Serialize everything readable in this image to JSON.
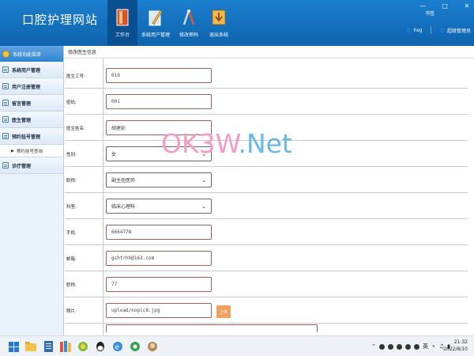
{
  "header": {
    "site_title": "口腔护理网站",
    "nav": [
      {
        "label": "工作台",
        "icon": "book-icon",
        "active": true
      },
      {
        "label": "系统用户管理",
        "icon": "pencil-icon",
        "active": false
      },
      {
        "label": "修改密码",
        "icon": "tools-icon",
        "active": false
      },
      {
        "label": "退出系统",
        "icon": "download-icon",
        "active": false
      }
    ],
    "bookmark": "书签",
    "window_controls": [
      "—",
      "□",
      "✕"
    ],
    "user_name": "hsg",
    "user_role": "超级管理员"
  },
  "sidebar": {
    "header": "系统功能菜单",
    "items": [
      {
        "label": "系统用户管理"
      },
      {
        "label": "用户注册管理"
      },
      {
        "label": "留言管理"
      },
      {
        "label": "医生管理"
      },
      {
        "label": "预约挂号管理"
      }
    ],
    "sub_item": "预约挂号查询",
    "last_item": "诊疗管理"
  },
  "main": {
    "breadcrumb": "修改医生信息",
    "fields": [
      {
        "label": "医生工号:",
        "value": "019",
        "type": "input"
      },
      {
        "label": "密码:",
        "value": "001",
        "type": "input"
      },
      {
        "label": "医生姓名:",
        "value": "胡建彭",
        "type": "input"
      },
      {
        "label": "性别:",
        "value": "女",
        "type": "select"
      },
      {
        "label": "职称:",
        "value": "副主任医师",
        "type": "select"
      },
      {
        "label": "科室:",
        "value": "临床心理科",
        "type": "select"
      },
      {
        "label": "手机:",
        "value": "6664778",
        "type": "input"
      },
      {
        "label": "邮箱:",
        "value": "gshtrhh@163.com",
        "type": "input"
      },
      {
        "label": "职称:",
        "value": "77",
        "type": "input"
      },
      {
        "label": "照片:",
        "value": "upload/nopic8.jpg",
        "type": "input"
      }
    ],
    "upload_label": "上传"
  },
  "watermark": {
    "a": "OK3W",
    "b": ".Net"
  },
  "taskbar": {
    "tray_lang": "英",
    "time": "21:32",
    "date": "2022/8/10"
  }
}
